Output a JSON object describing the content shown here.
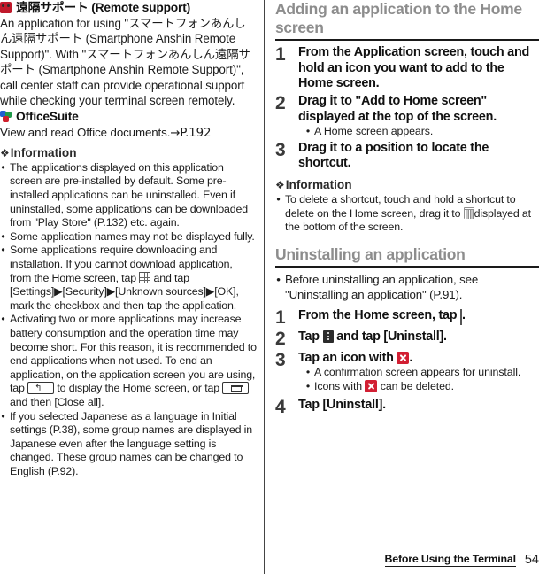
{
  "left_column": {
    "apps": [
      {
        "icon": "remote-support-icon",
        "title": "遠隔サポート (Remote support)",
        "description": "An application for using \"スマートフォンあんしん遠隔サポート (Smartphone Anshin Remote Support)\". With \"スマートフォンあんしん遠隔サポート (Smartphone Anshin Remote Support)\", call center staff can provide operational support while checking your terminal screen remotely."
      },
      {
        "icon": "officesuite-icon",
        "title": "OfficeSuite",
        "description": "View and read Office documents.",
        "reference": "→P.192"
      }
    ],
    "information": {
      "diamond": "❖",
      "heading": "Information",
      "bullets": [
        {
          "parts": [
            {
              "type": "text",
              "value": "The applications displayed on this application screen are pre-installed by default. Some pre-installed applications can be uninstalled. Even if uninstalled, some applications can be downloaded from \"Play Store\" (P.132) etc. again."
            }
          ]
        },
        {
          "parts": [
            {
              "type": "text",
              "value": "Some application names may not be displayed fully."
            }
          ]
        },
        {
          "parts": [
            {
              "type": "text",
              "value": "Some applications require downloading and installation. If you cannot download application, from the Home screen, tap "
            },
            {
              "type": "icon",
              "value": "app-grid-icon"
            },
            {
              "type": "text",
              "value": " and tap [Settings]▶[Security]▶[Unknown sources]▶[OK], mark the checkbox and then tap the application."
            }
          ]
        },
        {
          "parts": [
            {
              "type": "text",
              "value": "Activating two or more applications may increase battery consumption and the operation time may become short. For this reason, it is recommended to end applications when not used. To end an application, on the application screen you are using, tap "
            },
            {
              "type": "icon",
              "value": "back-key-icon"
            },
            {
              "type": "text",
              "value": " to display the Home screen, or tap "
            },
            {
              "type": "icon",
              "value": "recents-key-icon"
            },
            {
              "type": "text",
              "value": " and then [Close all]."
            }
          ]
        },
        {
          "parts": [
            {
              "type": "text",
              "value": "If you selected Japanese as a language in Initial settings (P.38), some group names are displayed in Japanese even after the language setting is changed. These group names can be changed to English (P.92)."
            }
          ]
        }
      ]
    }
  },
  "right_column": {
    "sections": [
      {
        "heading": "Adding an application to the Home screen",
        "steps": [
          {
            "number": "1",
            "text": "From the Application screen, touch and hold an icon you want to add to the Home screen.",
            "subs": []
          },
          {
            "number": "2",
            "text": "Drag it to \"Add to Home screen\" displayed at the top of the screen.",
            "subs": [
              "A Home screen appears."
            ]
          },
          {
            "number": "3",
            "text": "Drag it to a position to locate the shortcut.",
            "subs": []
          }
        ],
        "information": {
          "diamond": "❖",
          "heading": "Information",
          "bullet_parts": [
            {
              "type": "text",
              "value": "To delete a shortcut, touch and hold a shortcut to delete on the Home screen, drag it to "
            },
            {
              "type": "icon",
              "value": "trash-icon"
            },
            {
              "type": "text",
              "value": "displayed at the bottom of the screen."
            }
          ]
        }
      },
      {
        "heading": "Uninstalling an application",
        "lead_bullet": "Before uninstalling an application, see \"Uninstalling an application\" (P.91).",
        "steps": [
          {
            "number": "1",
            "parts": [
              {
                "type": "text",
                "value": "From the Home screen, tap "
              },
              {
                "type": "icon",
                "value": "app-grid-icon"
              },
              {
                "type": "text",
                "value": "."
              }
            ],
            "subs": []
          },
          {
            "number": "2",
            "parts": [
              {
                "type": "text",
                "value": "Tap "
              },
              {
                "type": "icon",
                "value": "overflow-menu-icon"
              },
              {
                "type": "text",
                "value": " and tap [Uninstall]."
              }
            ],
            "subs": []
          },
          {
            "number": "3",
            "parts": [
              {
                "type": "text",
                "value": "Tap an icon with "
              },
              {
                "type": "icon",
                "value": "red-x-icon"
              },
              {
                "type": "text",
                "value": "."
              }
            ],
            "subs": [
              {
                "parts": [
                  {
                    "type": "text",
                    "value": "A confirmation screen appears for uninstall."
                  }
                ]
              },
              {
                "parts": [
                  {
                    "type": "text",
                    "value": "Icons with "
                  },
                  {
                    "type": "icon",
                    "value": "red-x-icon"
                  },
                  {
                    "type": "text",
                    "value": " can be deleted."
                  }
                ]
              }
            ]
          },
          {
            "number": "4",
            "parts": [
              {
                "type": "text",
                "value": "Tap [Uninstall]."
              }
            ],
            "subs": []
          }
        ]
      }
    ]
  },
  "footer": {
    "chapter": "Before Using the Terminal",
    "page_number": "54"
  },
  "colors": {
    "heading_gray": "#8d8d8d",
    "rule_black": "#1a1a1a",
    "accent_red": "#d21f33",
    "remote_icon_red": "#c0192b"
  }
}
